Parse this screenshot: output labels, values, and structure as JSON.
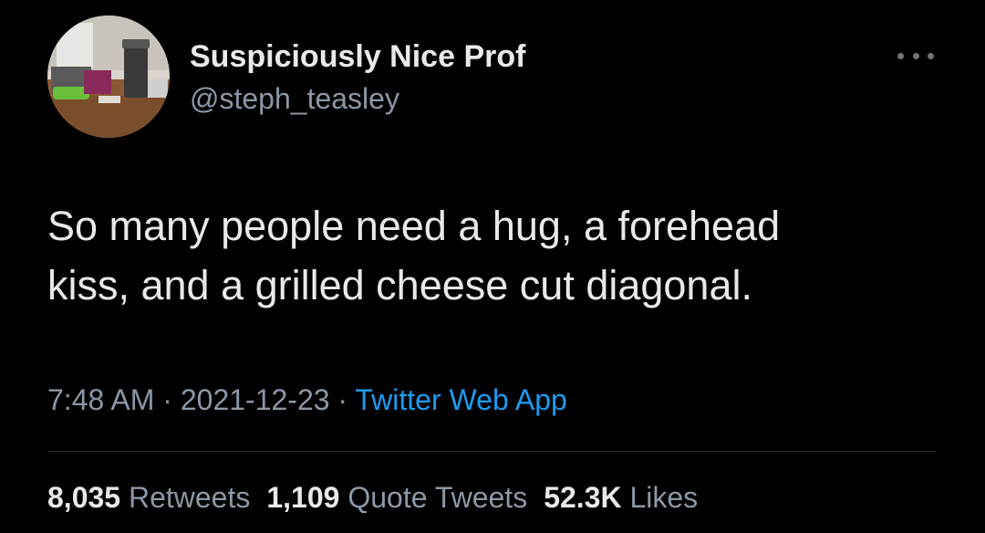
{
  "author": {
    "display_name": "Suspiciously Nice Prof",
    "handle": "@steph_teasley"
  },
  "tweet": {
    "lines": [
      "So many people need a hug, a forehead",
      "kiss, and a grilled cheese cut diagonal."
    ]
  },
  "meta": {
    "time": "7:48 AM",
    "separator": " · ",
    "date": "2021-12-23",
    "source": "Twitter Web App"
  },
  "stats": {
    "retweets": {
      "count": "8,035",
      "label": "Retweets"
    },
    "quotes": {
      "count": "1,109",
      "label": "Quote Tweets"
    },
    "likes": {
      "count": "52.3K",
      "label": "Likes"
    }
  },
  "icons": {
    "more": "more-horizontal-icon"
  },
  "colors": {
    "background": "#000000",
    "primary_text": "#e7e9ea",
    "secondary_text": "#8b98a5",
    "link": "#1d9bf0",
    "divider": "#2f3336"
  }
}
